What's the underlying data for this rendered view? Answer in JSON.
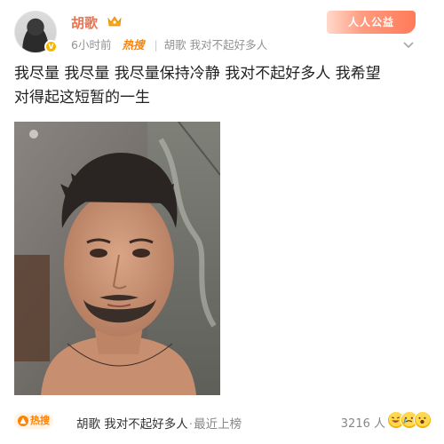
{
  "post": {
    "author": "胡歌",
    "time": "6小时前",
    "hot_label": "热搜",
    "separator": "|",
    "topic": "胡歌 我对不起好多人",
    "badge": "人人公益",
    "text_line1": "我尽量 我尽量 我尽量保持冷静 我对不起好多人 我希望",
    "text_line2": "对得起这短暂的一生"
  },
  "footer": {
    "hot_tag": "热搜",
    "topic": "胡歌 我对不起好多人",
    "dot": "·",
    "rank_text": "最近上榜",
    "count": "3216 人"
  }
}
